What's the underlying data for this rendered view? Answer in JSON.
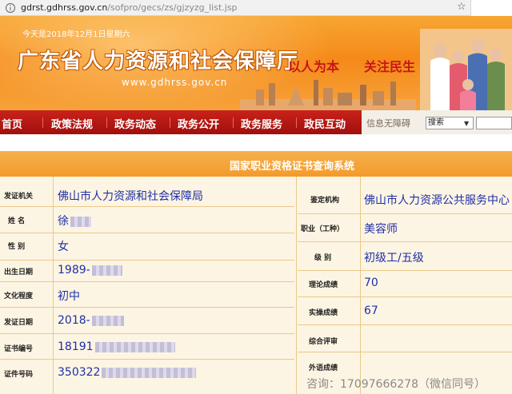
{
  "browser": {
    "url_host": "gdrst.gdhrss.gov.cn",
    "url_path": "/sofpro/gecs/zs/gjzyzg_list.jsp"
  },
  "banner": {
    "date": "今天是2018年12月1日星期六",
    "title": "广东省人力资源和社会保障厅",
    "site": "www.gdhrss.gov.cn",
    "slogan_left": "以人为本",
    "slogan_right": "关注民生"
  },
  "nav": {
    "items": [
      "首页",
      "政策法规",
      "政务动态",
      "政务公开",
      "政务服务",
      "政民互动"
    ],
    "accessibility": "信息无障碍",
    "search_value": "搜索"
  },
  "system_title": "国家职业资格证书查询系统",
  "left_fields": [
    {
      "label": "发证机关",
      "value": "佛山市人力资源和社会保障局",
      "masked": false
    },
    {
      "label": "姓    名",
      "value": "徐",
      "masked": true
    },
    {
      "label": "性    别",
      "value": "女",
      "masked": false
    },
    {
      "label": "出生日期",
      "value": "1989-",
      "masked": true
    },
    {
      "label": "文化程度",
      "value": "初中",
      "masked": false
    },
    {
      "label": "发证日期",
      "value": "2018-",
      "masked": true
    },
    {
      "label": "证书编号",
      "value": "18191",
      "masked": true
    },
    {
      "label": "证件号码",
      "value": "350322",
      "masked": true
    }
  ],
  "right_fields": [
    {
      "label": "鉴定机构",
      "value": "佛山市人力资源公共服务中心"
    },
    {
      "label": "职业（工种）",
      "value": "美容师"
    },
    {
      "label": "级    别",
      "value": "初级工/五级"
    },
    {
      "label": "理论成绩",
      "value": "70"
    },
    {
      "label": "实操成绩",
      "value": "67"
    },
    {
      "label": "综合评审",
      "value": ""
    },
    {
      "label": "外语成绩",
      "value": ""
    }
  ],
  "watermark": "咨询：17097666278（微信同号）",
  "colors": {
    "nav_red": "#b5170f",
    "header_orange": "#f3a03a",
    "value_blue": "#1f2fa8",
    "table_bg": "#fdf5e3"
  }
}
